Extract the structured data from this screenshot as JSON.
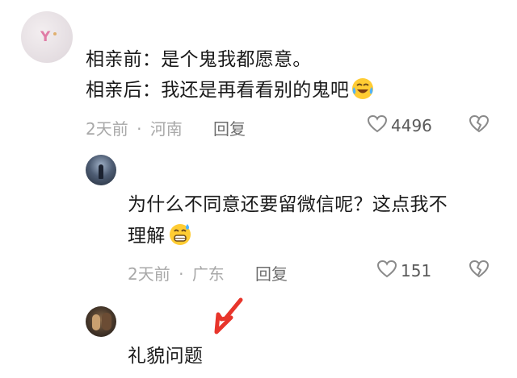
{
  "comments": [
    {
      "lines": [
        "相亲前：是个鬼我都愿意。",
        "相亲后：我还是再看看别的鬼吧"
      ],
      "emoji": "laughing-crying-emoji",
      "time": "2天前",
      "sep": "·",
      "location": "河南",
      "reply": "回复",
      "likes": "4496"
    },
    {
      "lines": [
        "为什么不同意还要留微信呢？这点我不",
        "理解"
      ],
      "emoji": "sweat-grin-emoji",
      "time": "2天前",
      "sep": "·",
      "location": "广东",
      "reply": "回复",
      "likes": "151"
    },
    {
      "lines": [
        "礼貌问题"
      ]
    }
  ],
  "colors": {
    "arrow": "#e8352b",
    "meta": "#a8a8a8",
    "icon": "#8a8a8a"
  },
  "icons": [
    "heart-outline-icon",
    "broken-heart-icon",
    "red-arrow-icon"
  ]
}
